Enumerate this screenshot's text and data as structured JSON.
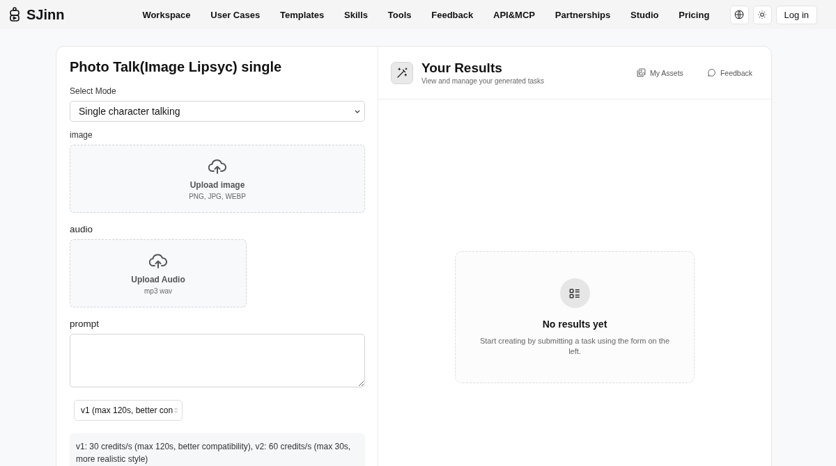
{
  "header": {
    "brand": "SJinn",
    "nav": [
      "Workspace",
      "User Cases",
      "Templates",
      "Skills",
      "Tools",
      "Feedback",
      "API&MCP",
      "Partnerships",
      "Studio",
      "Pricing"
    ],
    "login": "Log in"
  },
  "form": {
    "title": "Photo Talk(Image Lipsyc) single",
    "mode_label": "Select Mode",
    "mode_value": "Single character talking",
    "uploads": [
      {
        "label": "image",
        "title": "Upload image",
        "formats": "PNG, JPG, WEBP",
        "kind": "wide"
      },
      {
        "label": "audio",
        "title": "Upload Audio",
        "formats": "mp3 wav",
        "kind": "narrow"
      }
    ],
    "prompt_label": "prompt",
    "version_value": "v1 (max 120s, better con",
    "info": "v1: 30 credits/s (max 120s, better compatibility), v2: 60 credits/s (max 30s, more realistic style)"
  },
  "results": {
    "title": "Your Results",
    "subtitle": "View and manage your generated tasks",
    "links": [
      "My Assets",
      "Feedback"
    ],
    "empty_title": "No results yet",
    "empty_text": "Start creating by submitting a task using the form on the left."
  }
}
